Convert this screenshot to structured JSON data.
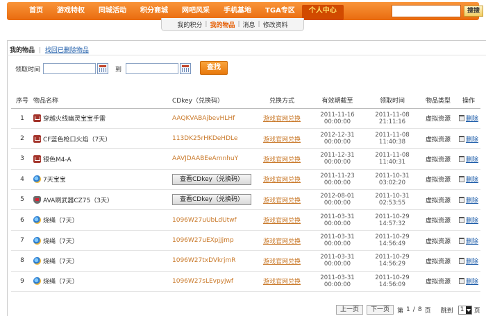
{
  "nav": {
    "items": [
      "首页",
      "游戏特权",
      "同城活动",
      "积分商城",
      "网吧风采",
      "手机基地",
      "TGA专区",
      "个人中心"
    ],
    "active_index": 7,
    "search_placeholder": "",
    "search_button": "搜搜"
  },
  "subnav": {
    "items": [
      "我的积分",
      "我的物品",
      "消息",
      "修改资料"
    ],
    "active_index": 1
  },
  "section": {
    "title": "我的物品",
    "restore_link": "找回已删除物品"
  },
  "filter": {
    "label": "领取时间",
    "to_label": "到",
    "start_value": "",
    "end_value": "",
    "search_button": "查找"
  },
  "table": {
    "headers": [
      "序号",
      "物品名称",
      "CDkey（兑换码）",
      "兑换方式",
      "有效期截至",
      "领取时间",
      "物品类型",
      "操作"
    ],
    "rows": [
      {
        "no": "1",
        "icon": "cf-game-icon",
        "name": "穿越火线幽灵宝宝手雷",
        "cdkey": "AAQKVABAjbevHLHf",
        "method": "游戏官网兑换",
        "expire_date": "2011-11-16",
        "expire_time": "00:00:00",
        "get_date": "2011-11-08",
        "get_time": "21:11:16",
        "type": "虚拟资源",
        "action": "删除"
      },
      {
        "no": "2",
        "icon": "cf-game-icon",
        "name": "CF蓝色枪口火焰（7天）",
        "cdkey": "113DK25rHKDeHDLe",
        "method": "游戏官网兑换",
        "expire_date": "2012-12-31",
        "expire_time": "00:00:00",
        "get_date": "2011-11-08",
        "get_time": "11:40:38",
        "type": "虚拟资源",
        "action": "删除"
      },
      {
        "no": "3",
        "icon": "cf-game-icon",
        "name": "银色M4-A",
        "cdkey": "AAVJDAABEeAmnhuY",
        "method": "游戏官网兑换",
        "expire_date": "2011-12-31",
        "expire_time": "00:00:00",
        "get_date": "2011-11-08",
        "get_time": "11:40:31",
        "type": "虚拟资源",
        "action": "删除"
      },
      {
        "no": "4",
        "icon": "ie-icon",
        "name": "7天宝宝",
        "cdkey_button": "查看CDkey（兑换码）",
        "method": "游戏官网兑换",
        "expire_date": "2011-11-23",
        "expire_time": "00:00:00",
        "get_date": "2011-10-31",
        "get_time": "03:02:20",
        "type": "虚拟资源",
        "action": "删除"
      },
      {
        "no": "5",
        "icon": "ava-game-icon",
        "name": "AVA刷武器CZ75（3天）",
        "cdkey_button": "查看CDkey（兑换码）",
        "method": "游戏官网兑换",
        "expire_date": "2012-08-01",
        "expire_time": "00:00:00",
        "get_date": "2011-10-31",
        "get_time": "02:53:55",
        "type": "虚拟资源",
        "action": "删除"
      },
      {
        "no": "6",
        "icon": "ie-icon",
        "name": "烧绳（7天）",
        "cdkey": "1096W27uUbLdUtwf",
        "method": "游戏官网兑换",
        "expire_date": "2011-03-31",
        "expire_time": "00:00:00",
        "get_date": "2011-10-29",
        "get_time": "14:57:32",
        "type": "虚拟资源",
        "action": "删除"
      },
      {
        "no": "7",
        "icon": "ie-icon",
        "name": "烧绳（7天）",
        "cdkey": "1096W27uEXpjJjmp",
        "method": "游戏官网兑换",
        "expire_date": "2011-03-31",
        "expire_time": "00:00:00",
        "get_date": "2011-10-29",
        "get_time": "14:56:49",
        "type": "虚拟资源",
        "action": "删除"
      },
      {
        "no": "8",
        "icon": "ie-icon",
        "name": "烧绳（7天）",
        "cdkey": "1096W27txDVkrjmR",
        "method": "游戏官网兑换",
        "expire_date": "2011-03-31",
        "expire_time": "00:00:00",
        "get_date": "2011-10-29",
        "get_time": "14:56:29",
        "type": "虚拟资源",
        "action": "删除"
      },
      {
        "no": "9",
        "icon": "ie-icon",
        "name": "烧绳（7天）",
        "cdkey": "1096W27sLEvpyjwf",
        "method": "游戏官网兑换",
        "expire_date": "2011-03-31",
        "expire_time": "00:00:00",
        "get_date": "2011-10-29",
        "get_time": "14:56:09",
        "type": "虚拟资源",
        "action": "删除"
      }
    ]
  },
  "pager": {
    "prev": "上一页",
    "next": "下一页",
    "page_prefix": "第",
    "current": "1",
    "page_sep": "/",
    "total": "8",
    "page_suffix": "页",
    "goto_prefix": "跳到",
    "goto_value": "1",
    "goto_suffix": "页"
  }
}
